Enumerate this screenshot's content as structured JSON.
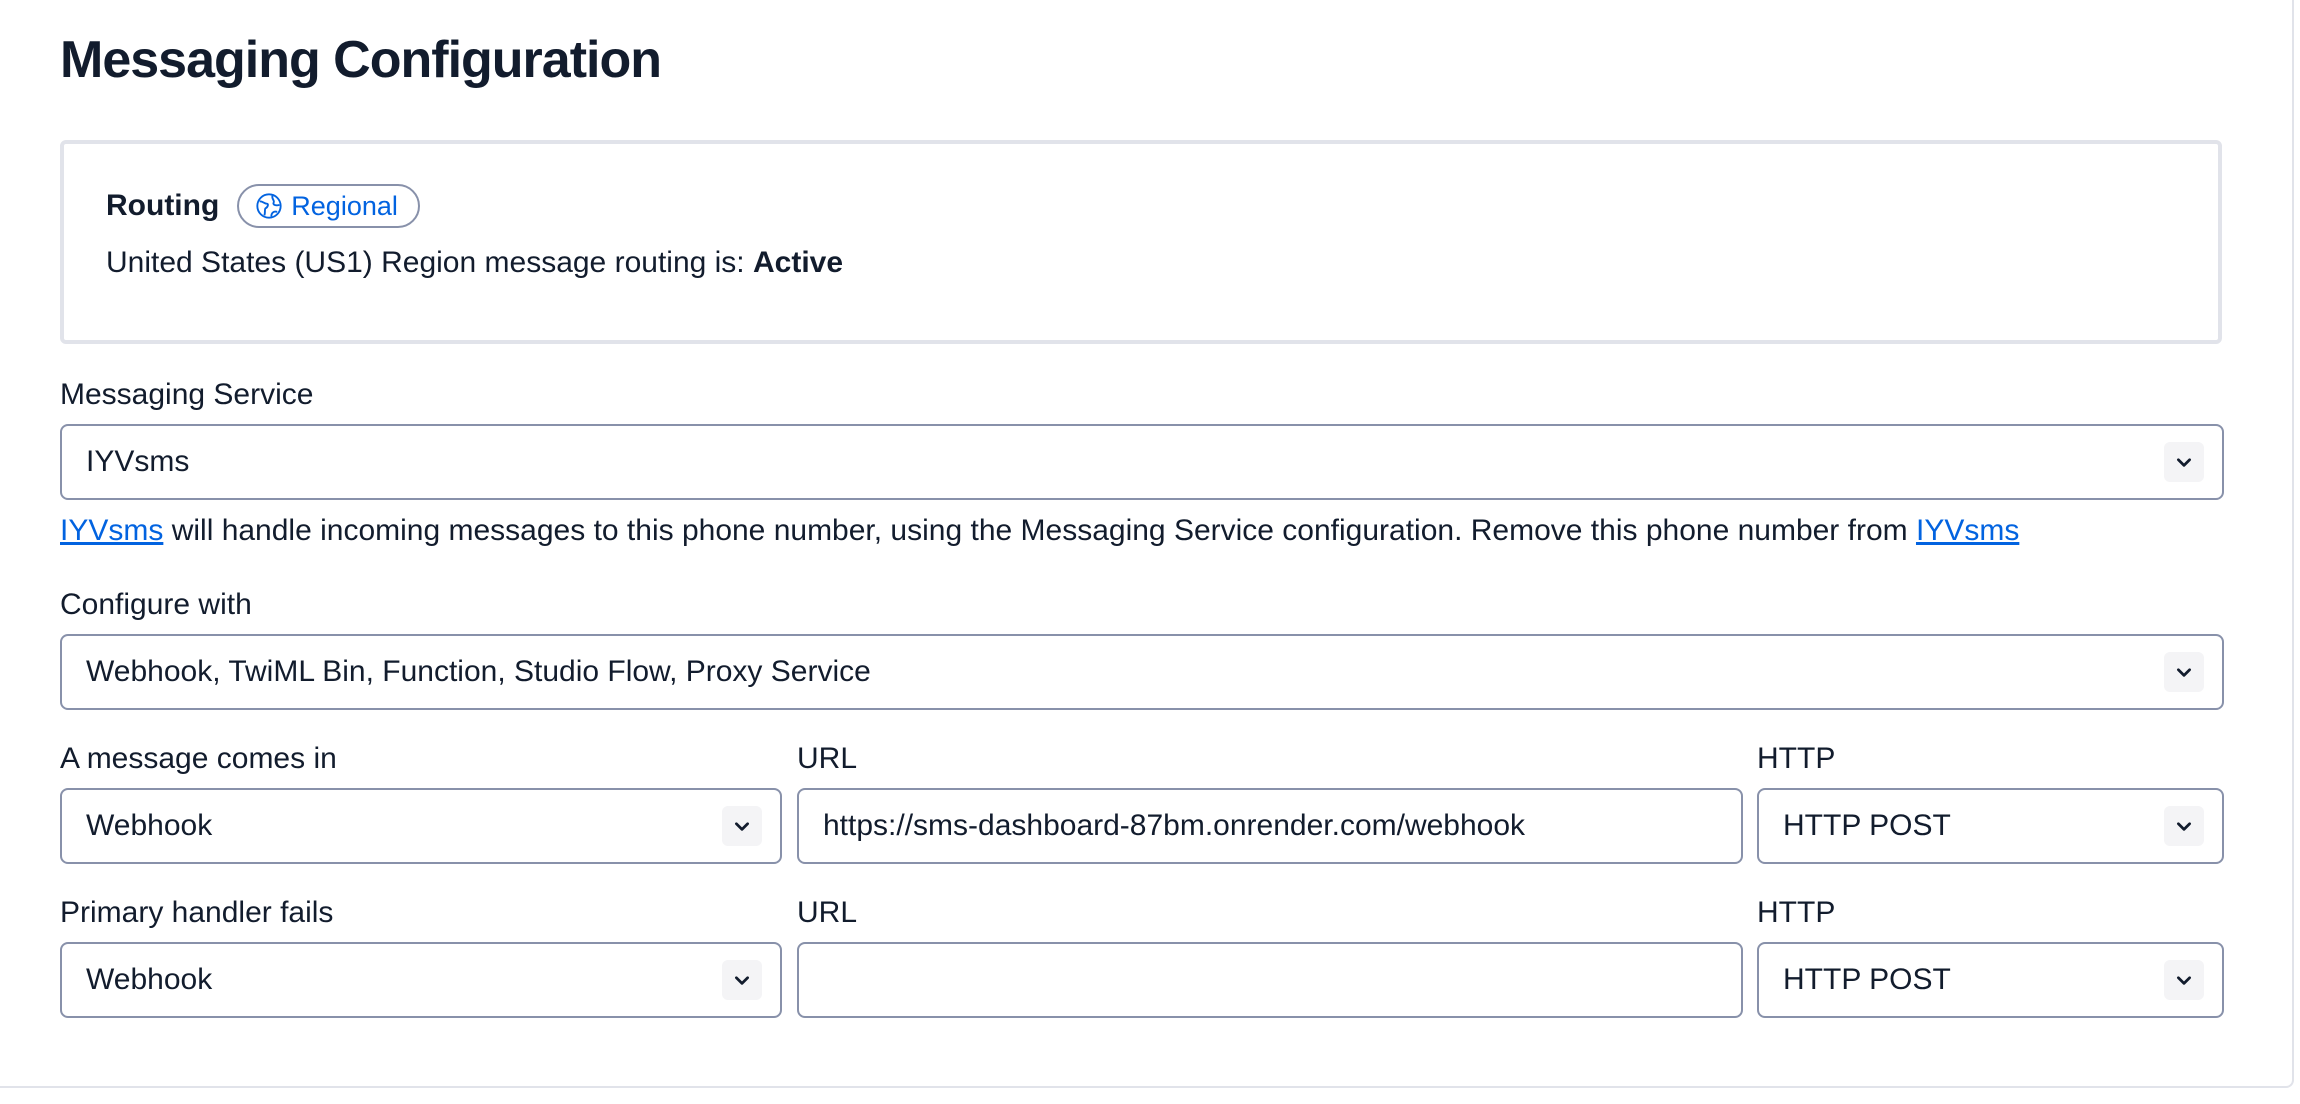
{
  "page_title": "Messaging Configuration",
  "routing": {
    "label": "Routing",
    "badge": "Regional",
    "badge_icon": "globe-icon",
    "status_prefix": "United States (US1) Region message routing is: ",
    "status_value": "Active"
  },
  "messaging_service": {
    "label": "Messaging Service",
    "value": "IYVsms"
  },
  "help": {
    "link1": "IYVsms",
    "middle": " will handle incoming messages to this phone number, using the Messaging Service configuration. Remove this phone number from ",
    "link2": "IYVsms"
  },
  "configure_with": {
    "label": "Configure with",
    "value": "Webhook, TwiML Bin, Function, Studio Flow, Proxy Service"
  },
  "message_comes_in": {
    "label": "A message comes in",
    "handler": "Webhook",
    "url_label": "URL",
    "url_value": "https://sms-dashboard-87bm.onrender.com/webhook",
    "http_label": "HTTP",
    "http_value": "HTTP POST"
  },
  "primary_handler_fails": {
    "label": "Primary handler fails",
    "handler": "Webhook",
    "url_label": "URL",
    "url_value": "",
    "http_label": "HTTP",
    "http_value": "HTTP POST"
  },
  "colors": {
    "text": "#121c2d",
    "link": "#0263e0",
    "border": "#8891aa",
    "card_border": "#e1e3ea"
  }
}
